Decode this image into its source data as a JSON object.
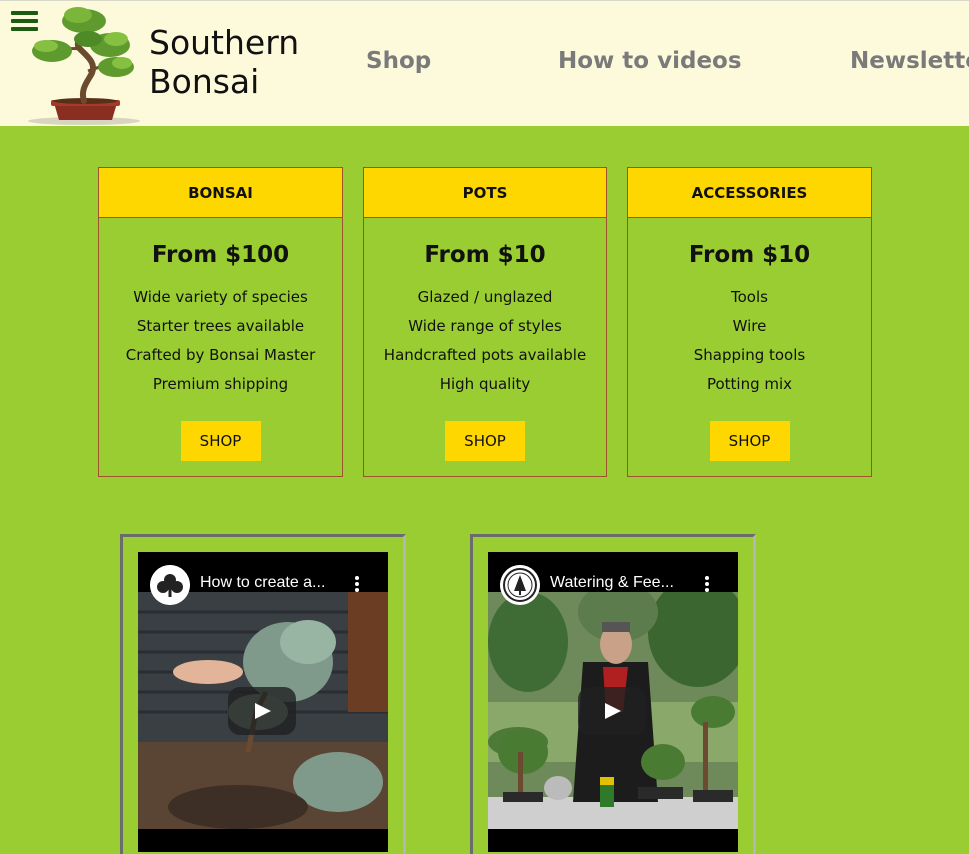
{
  "site": {
    "title_line1": "Southern",
    "title_line2": "Bonsai"
  },
  "nav": {
    "shop": "Shop",
    "videos": "How to videos",
    "newsletter": "Newsletter"
  },
  "colors": {
    "page_bg": "#9acd32",
    "header_bg": "#fdfadc",
    "card_head": "#ffd700",
    "card_border": "#a0522d",
    "nav_text": "#7a7a7a"
  },
  "cards": [
    {
      "heading": "BONSAI",
      "price": "From $100",
      "features": [
        "Wide variety of species",
        "Starter trees available",
        "Crafted by Bonsai Master",
        "Premium shipping"
      ],
      "button": "SHOP"
    },
    {
      "heading": "POTS",
      "price": "From $10",
      "features": [
        "Glazed / unglazed",
        "Wide range of styles",
        "Handcrafted pots available",
        "High quality"
      ],
      "button": "SHOP"
    },
    {
      "heading": "ACCESSORIES",
      "price": "From $10",
      "features": [
        "Tools",
        "Wire",
        "Shapping tools",
        "Potting mix"
      ],
      "button": "SHOP"
    }
  ],
  "videos": [
    {
      "title": "How to create a...",
      "icon": "play-icon"
    },
    {
      "title": "Watering & Fee...",
      "icon": "play-icon"
    }
  ],
  "icons": {
    "menu": "hamburger-menu-icon",
    "logo": "bonsai-tree-logo",
    "more": "more-vertical-icon",
    "play": "play-icon"
  }
}
